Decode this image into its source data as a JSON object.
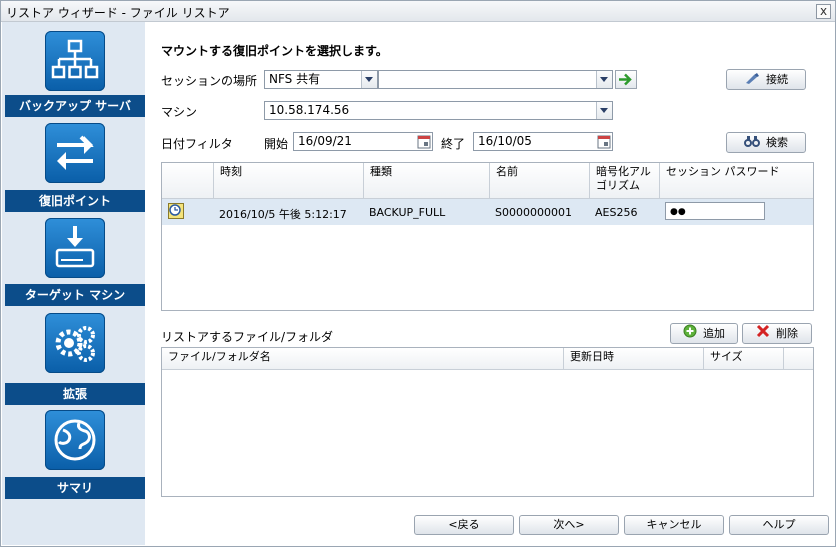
{
  "window": {
    "title": "リストア ウィザード - ファイル リストア",
    "close_glyph": "x"
  },
  "sidebar": {
    "items": [
      {
        "label": "バックアップ サーバ",
        "icon": "network-server-icon"
      },
      {
        "label": "復旧ポイント",
        "icon": "arrows-exchange-icon"
      },
      {
        "label": "ターゲット マシン",
        "icon": "drive-download-icon"
      },
      {
        "label": "拡張",
        "icon": "gears-icon"
      },
      {
        "label": "サマリ",
        "icon": "globe-icon"
      }
    ]
  },
  "main": {
    "heading": "マウントする復旧ポイントを選択します。",
    "session_location": {
      "label": "セッションの場所",
      "type_value": "NFS 共有",
      "path_value": "",
      "connect_label": "接続"
    },
    "machine": {
      "label": "マシン",
      "value": "10.58.174.56"
    },
    "date_filter": {
      "label": "日付フィルタ",
      "start_label": "開始",
      "start_value": "16/09/21",
      "end_label": "終了",
      "end_value": "16/10/05",
      "search_label": "検索"
    },
    "sessions_table": {
      "columns": [
        "時刻",
        "種類",
        "名前",
        "暗号化アル\nゴリズム",
        "セッション パスワード"
      ],
      "rows": [
        {
          "time": "2016/10/5 午後 5:12:17",
          "type": "BACKUP_FULL",
          "name": "S0000000001",
          "algorithm": "AES256",
          "password": "●●"
        }
      ]
    },
    "files": {
      "label": "リストアするファイル/フォルダ",
      "add_label": "追加",
      "delete_label": "削除",
      "columns": [
        "ファイル/フォルダ名",
        "更新日時",
        "サイズ"
      ]
    },
    "footer": {
      "back": "<戻る",
      "next": "次へ>",
      "cancel": "キャンセル",
      "help": "ヘルプ"
    }
  },
  "colors": {
    "accent": "#0c4d8a",
    "sidebar_bg": "#dfe8f2",
    "row_selected": "#dde8f3"
  }
}
